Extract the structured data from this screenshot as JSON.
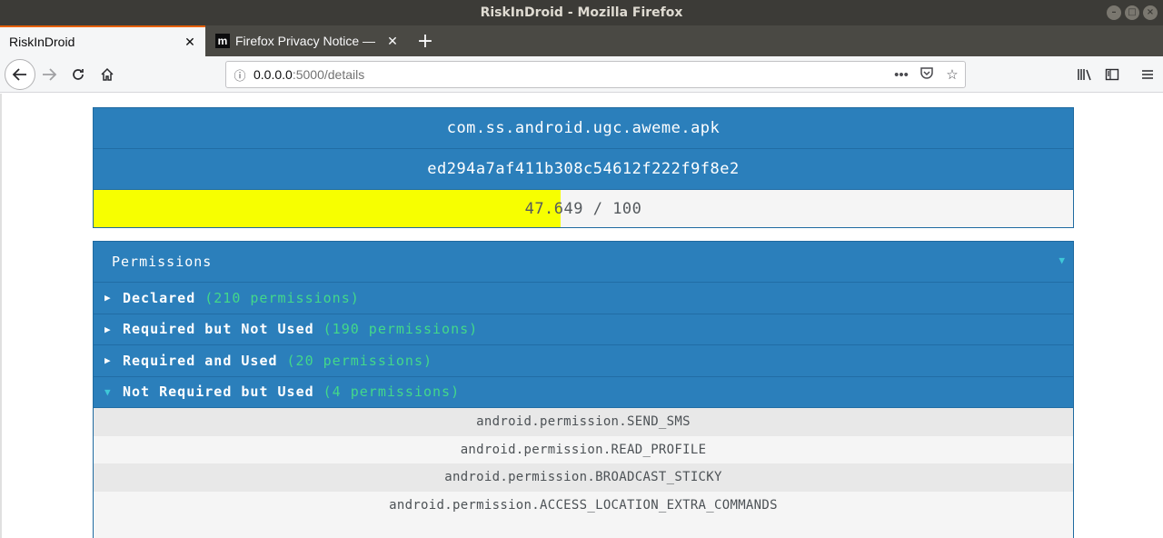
{
  "window": {
    "title": "RiskInDroid - Mozilla Firefox"
  },
  "tabs": [
    {
      "label": "RiskInDroid",
      "active": true
    },
    {
      "label": "Firefox Privacy Notice —",
      "favicon": "m",
      "active": false
    }
  ],
  "url": {
    "host": "0.0.0.0",
    "rest": ":5000/details"
  },
  "icons": {
    "back": "back-arrow-icon",
    "forward": "forward-arrow-icon",
    "reload": "reload-icon",
    "home": "home-icon",
    "info": "info-icon",
    "more": "more-icon",
    "pocket": "pocket-icon",
    "star": "bookmark-star-icon",
    "library": "library-icon",
    "sidebar": "sidebar-icon",
    "menu": "hamburger-menu-icon"
  },
  "app": {
    "apk_name": "com.ss.android.ugc.aweme.apk",
    "apk_hash": "ed294a7af411b308c54612f222f9f8e2",
    "score_text": "47.649 / 100",
    "score_value": 47.649,
    "score_max": 100,
    "score_color": "#f7ff00"
  },
  "permissions": {
    "title": "Permissions",
    "groups": [
      {
        "label": "Declared",
        "count": "(210 permissions)",
        "expanded": false
      },
      {
        "label": "Required but Not Used",
        "count": "(190 permissions)",
        "expanded": false
      },
      {
        "label": "Required and Used",
        "count": "(20 permissions)",
        "expanded": false
      },
      {
        "label": "Not Required but Used",
        "count": "(4 permissions)",
        "expanded": true
      }
    ],
    "items": [
      "android.permission.SEND_SMS",
      "android.permission.READ_PROFILE",
      "android.permission.BROADCAST_STICKY",
      "android.permission.ACCESS_LOCATION_EXTRA_COMMANDS"
    ]
  },
  "colors": {
    "header_blue": "#2b7fbb",
    "count_green": "#43d88a",
    "caret_teal": "#3ec8d8"
  }
}
